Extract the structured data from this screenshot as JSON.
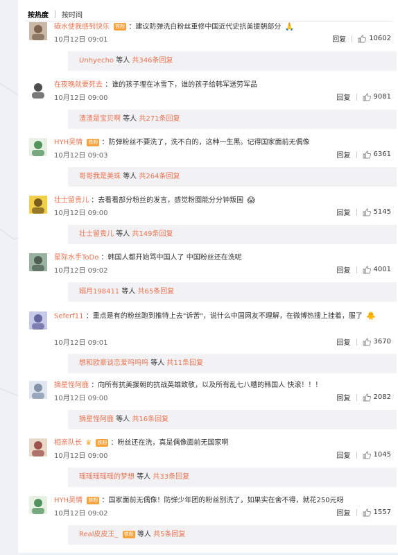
{
  "tabs": {
    "hot": "按热度",
    "time": "按时间"
  },
  "common": {
    "reply": "回复",
    "many_people": "等人",
    "badge": "铁粉"
  },
  "comments": [
    {
      "user": "碳水使我感到快乐",
      "badge": true,
      "text": "建议防弹洗白粉丝重修中国近代史抗美援朝部分",
      "emoji": "🙏",
      "time": "10月12日 09:01",
      "likes": "10602",
      "sub_user": "Unhyecho",
      "sub_count": "共346条回复"
    },
    {
      "user": "在夜晚就要死去",
      "badge": false,
      "text": "谁的孩子埋在冰雪下，谁的孩子给韩军送劳军品",
      "emoji": "",
      "time": "10月12日 09:00",
      "likes": "9081",
      "sub_user": "渣渣是宝贝啊",
      "sub_count": "共271条回复"
    },
    {
      "user": "HYH吴情",
      "badge": true,
      "text": "防弹粉丝不要洗了，洗不白的，这种一生黑。记得国家面前无偶像",
      "emoji": "",
      "time": "10月12日 09:03",
      "likes": "6361",
      "sub_user": "哥哥我是美珠",
      "sub_count": "共264条回复"
    },
    {
      "user": "壮士留贵儿",
      "badge": false,
      "text": "去看看部分粉丝的发言，感觉粉圈能分分钟叛国",
      "emoji": "😱",
      "time": "10月12日 09:00",
      "likes": "5145",
      "sub_user": "壮士留贵儿",
      "sub_count": "共149条回复"
    },
    {
      "user": "星际水手ToDo",
      "badge": false,
      "text": "韩国人都开始骂中国人了 中国粉丝还在洗呢",
      "emoji": "",
      "time": "10月12日 09:02",
      "likes": "4001",
      "sub_user": "嫋月198411",
      "sub_count": "共65条回复"
    },
    {
      "user": "Seferf11",
      "badge": false,
      "text": "重点是有的粉丝跑到推特上去\"诉苦\"，说什么中国网友不理解，在微博热搜上挂着，服了",
      "emoji": "🐥",
      "time": "10月12日 09:01",
      "likes": "3670",
      "sub_user": "想和欧豪谈恋爱呜呜呜",
      "sub_count": "共11条回复"
    },
    {
      "user": "摘星怪阿鹿",
      "badge": false,
      "text": "向所有抗美援朝的抗战英雄致敬，以及所有乱七八糟的韩国人 快滚！！！",
      "emoji": "",
      "time": "10月12日 09:00",
      "likes": "2082",
      "sub_user": "摘星怪阿鹿",
      "sub_count": "共16条回复"
    },
    {
      "user": "相亲队长",
      "badge": true,
      "crown": true,
      "text": "粉丝还在洗，真是偶像面前无国家啊",
      "emoji": "",
      "time": "10月12日 09:00",
      "likes": "1045",
      "sub_user": "瑶瑶瑶瑶瑶的梦想",
      "sub_count": "共33条回复"
    },
    {
      "user": "HYH吴情",
      "badge": true,
      "text": "国家面前无偶像！防弹少年团的粉丝别洗了，如果实在舍不得，就花250元呀",
      "emoji": "",
      "time": "10月12日 09:02",
      "likes": "1557",
      "sub_user": "Real皮皮王_",
      "sub_count": "共5条回复"
    }
  ],
  "colors": {
    "username": "#eb7350",
    "badge": "#f7a23b",
    "subbox": "#f2f2f5"
  },
  "icons": {
    "like": "thumbs-up-icon"
  }
}
